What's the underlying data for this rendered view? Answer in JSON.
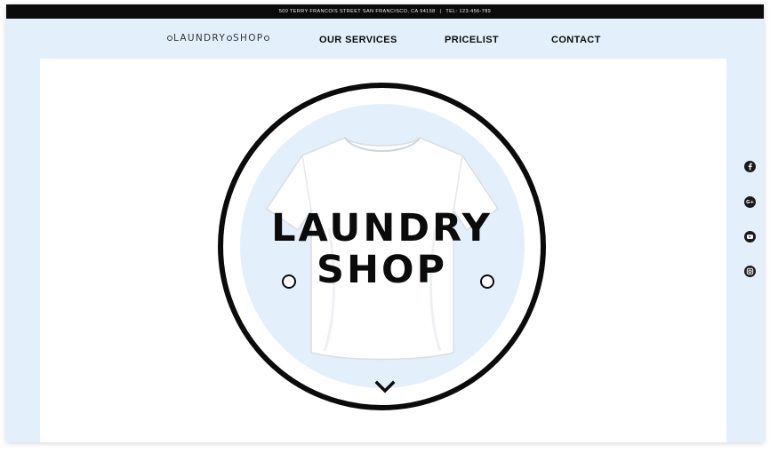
{
  "topbar": {
    "address": "500 TERRY FRANCOIS STREET SAN FRANCISCO, CA 94158",
    "separator": "|",
    "phone": "TEL: 123-456-789"
  },
  "header": {
    "logo_part1": "LAUNDRY",
    "logo_part2": "SHOP",
    "nav": {
      "services": "OUR SERVICES",
      "pricelist": "PRICELIST",
      "contact": "CONTACT"
    }
  },
  "hero": {
    "title_line1": "LAUNDRY",
    "title_line2": "SHOP",
    "scroll_icon": "chevron-down-icon"
  },
  "social": {
    "icons": [
      "facebook-icon",
      "google-plus-icon",
      "youtube-icon",
      "instagram-icon"
    ],
    "google_plus_glyph": "G+"
  },
  "colors": {
    "background": "#e3f0fc",
    "panel": "#ffffff",
    "topbar": "#0b0b0b",
    "text": "#0b0b0b"
  }
}
